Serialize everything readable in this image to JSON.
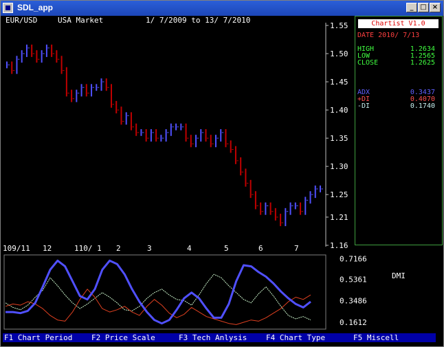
{
  "window": {
    "title": "SDL_app",
    "min_glyph": "_",
    "max_glyph": "□",
    "close_glyph": "×"
  },
  "header": {
    "symbol": "EUR/USD",
    "market": "USA Market",
    "range": "1/ 7/2009 to 13/ 7/2010"
  },
  "info": {
    "badge": "Chartist V1.0",
    "date": "DATE 2010/ 7/13",
    "high_label": "HIGH",
    "high": "1.2634",
    "low_label": "LOW",
    "low": "1.2565",
    "close_label": "CLOSE",
    "close": "1.2625",
    "adx_label": "ADX",
    "adx": "0.3437",
    "pdi_label": "+DI",
    "pdi": "0.4070",
    "mdi_label": "-DI",
    "mdi": "0.1740"
  },
  "price_axis": [
    "1.55",
    "1.50",
    "1.45",
    "1.40",
    "1.35",
    "1.30",
    "1.25",
    "1.21",
    "1.16"
  ],
  "time_axis": [
    "109/11",
    "12",
    "110/ 1",
    "2",
    "3",
    "4",
    "5",
    "6",
    "7"
  ],
  "dmi_axis": [
    "0.7166",
    "0.5361",
    "0.3486",
    "0.1612"
  ],
  "dmi_label": "DMI",
  "fkeys": [
    "F1 Chart Period",
    "F2 Price Scale",
    "F3 Tech Anlysis",
    "F4 Chart Type",
    "F5 Miscell"
  ],
  "colors": {
    "up": "#5050ff",
    "down": "#c00000",
    "adx": "#5050ff",
    "pdi": "#e04020",
    "mdi": "#c8f0c8",
    "panel_border": "#40a040"
  },
  "chart_data": {
    "type": "bar",
    "price": {
      "ylim": [
        1.16,
        1.55
      ],
      "series": [
        1.48,
        1.47,
        1.49,
        1.5,
        1.51,
        1.5,
        1.49,
        1.5,
        1.51,
        1.5,
        1.49,
        1.47,
        1.43,
        1.42,
        1.43,
        1.44,
        1.43,
        1.44,
        1.44,
        1.45,
        1.44,
        1.41,
        1.4,
        1.38,
        1.39,
        1.37,
        1.36,
        1.36,
        1.35,
        1.36,
        1.35,
        1.35,
        1.36,
        1.37,
        1.37,
        1.37,
        1.35,
        1.34,
        1.35,
        1.36,
        1.35,
        1.34,
        1.35,
        1.36,
        1.34,
        1.33,
        1.31,
        1.29,
        1.27,
        1.25,
        1.23,
        1.22,
        1.23,
        1.22,
        1.21,
        1.2,
        1.22,
        1.23,
        1.23,
        1.22,
        1.24,
        1.25,
        1.26,
        1.26
      ]
    },
    "dmi": {
      "ylim": [
        0.1,
        0.75
      ],
      "adx": [
        0.25,
        0.25,
        0.24,
        0.26,
        0.33,
        0.47,
        0.62,
        0.7,
        0.65,
        0.52,
        0.39,
        0.36,
        0.45,
        0.62,
        0.7,
        0.67,
        0.58,
        0.45,
        0.34,
        0.25,
        0.18,
        0.15,
        0.18,
        0.27,
        0.37,
        0.42,
        0.37,
        0.28,
        0.2,
        0.2,
        0.32,
        0.52,
        0.66,
        0.65,
        0.6,
        0.56,
        0.5,
        0.43,
        0.37,
        0.32,
        0.29,
        0.34
      ],
      "pdi": [
        0.3,
        0.32,
        0.31,
        0.34,
        0.32,
        0.28,
        0.22,
        0.18,
        0.17,
        0.25,
        0.36,
        0.45,
        0.38,
        0.28,
        0.25,
        0.27,
        0.3,
        0.25,
        0.22,
        0.3,
        0.36,
        0.31,
        0.24,
        0.2,
        0.23,
        0.29,
        0.25,
        0.21,
        0.19,
        0.17,
        0.15,
        0.14,
        0.16,
        0.18,
        0.17,
        0.2,
        0.24,
        0.28,
        0.34,
        0.38,
        0.36,
        0.4
      ],
      "mdi": [
        0.33,
        0.29,
        0.27,
        0.31,
        0.38,
        0.44,
        0.55,
        0.48,
        0.4,
        0.33,
        0.28,
        0.32,
        0.37,
        0.42,
        0.38,
        0.33,
        0.27,
        0.26,
        0.3,
        0.37,
        0.42,
        0.45,
        0.4,
        0.36,
        0.35,
        0.31,
        0.4,
        0.5,
        0.58,
        0.55,
        0.48,
        0.42,
        0.36,
        0.33,
        0.41,
        0.47,
        0.39,
        0.3,
        0.22,
        0.19,
        0.21,
        0.18
      ]
    }
  }
}
